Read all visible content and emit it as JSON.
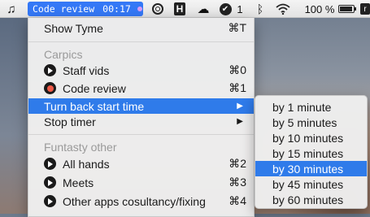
{
  "menubar": {
    "timer": {
      "name": "Code review",
      "time": "00:17"
    },
    "notification_count": "1",
    "battery_percent": "100 %",
    "music_icon": "music-note-icon",
    "cut_icon_letter": "r"
  },
  "menu": {
    "show_app": {
      "label": "Show Tyme",
      "shortcut": "⌘T"
    },
    "group1": {
      "header": "Carpics",
      "items": [
        {
          "label": "Staff vids",
          "shortcut": "⌘0",
          "icon": "play-icon"
        },
        {
          "label": "Code review",
          "shortcut": "⌘1",
          "icon": "record-icon"
        }
      ]
    },
    "turn_back": {
      "label": "Turn back start time",
      "arrow": "▶"
    },
    "stop_timer": {
      "label": "Stop timer",
      "arrow": "▶"
    },
    "group2": {
      "header": "Funtasty other",
      "items": [
        {
          "label": "All hands",
          "shortcut": "⌘2",
          "icon": "play-icon"
        },
        {
          "label": "Meets",
          "shortcut": "⌘3",
          "icon": "play-icon"
        },
        {
          "label": "Other apps cosultancy/fixing",
          "shortcut": "⌘4",
          "icon": "play-icon"
        }
      ]
    }
  },
  "submenu": {
    "items": [
      "by 1 minute",
      "by 5 minutes",
      "by 10 minutes",
      "by 15 minutes",
      "by 30 minutes",
      "by 45 minutes",
      "by 60 minutes"
    ],
    "selected": "by 30 minutes"
  },
  "colors": {
    "accent": "#2f7bea",
    "timer_bg": "#3478f6",
    "record_dot": "#ef5a48",
    "timer_dot": "#d89cf5"
  }
}
